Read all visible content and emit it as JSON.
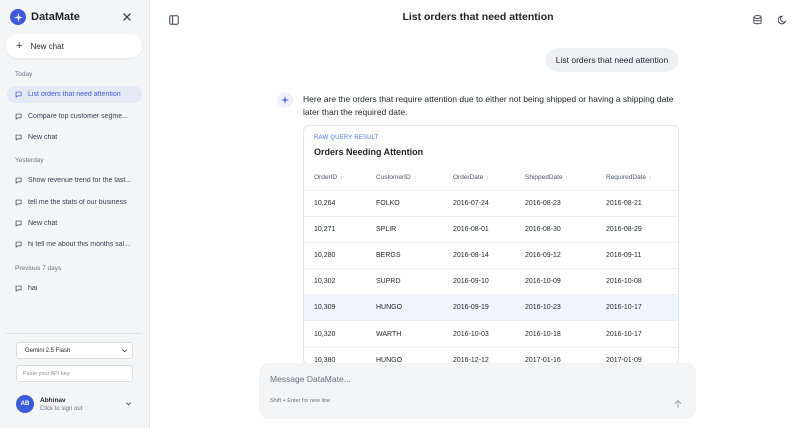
{
  "app": {
    "name": "DataMate"
  },
  "sidebar": {
    "new_chat_label": "New chat",
    "sections": [
      {
        "label": "Today",
        "items": [
          {
            "label": "List orders that need attention",
            "active": true
          },
          {
            "label": "Compare top customer segme..."
          },
          {
            "label": "New chat"
          }
        ]
      },
      {
        "label": "Yesterday",
        "items": [
          {
            "label": "Show revenue trend for the last..."
          },
          {
            "label": "tell me the stats of our business"
          },
          {
            "label": "New chat"
          },
          {
            "label": "hi tell me about this months sal..."
          }
        ]
      },
      {
        "label": "Previous 7 days",
        "items": [
          {
            "label": "hai"
          }
        ]
      }
    ],
    "model_select": {
      "value": "Gemini 2.5 Flash"
    },
    "api_key": {
      "placeholder": "Paste your API key"
    },
    "user": {
      "initials": "AB",
      "name": "Abhinav",
      "subtitle": "Click to sign out"
    }
  },
  "header": {
    "title": "List orders that need attention"
  },
  "conversation": {
    "user_message": "List orders that need attention",
    "assistant_message": "Here are the orders that require attention due to either not being shipped or having a shipping date later than the required date.",
    "result": {
      "kicker": "RAW QUERY RESULT",
      "title": "Orders Needing Attention",
      "columns": [
        "OrderID",
        "CustomerID",
        "OrderDate",
        "ShippedDate",
        "RequiredDate"
      ],
      "rows": [
        [
          "10,264",
          "FOLKO",
          "2016-07-24",
          "2016-08-23",
          "2016-08-21"
        ],
        [
          "10,271",
          "SPLIR",
          "2016-08-01",
          "2016-08-30",
          "2016-08-29"
        ],
        [
          "10,280",
          "BERGS",
          "2016-08-14",
          "2016-09-12",
          "2016-09-11"
        ],
        [
          "10,302",
          "SUPRD",
          "2016-09-10",
          "2016-10-09",
          "2016-10-08"
        ],
        [
          "10,309",
          "HUNGO",
          "2016-09-19",
          "2016-10-23",
          "2016-10-17"
        ],
        [
          "10,320",
          "WARTH",
          "2016-10-03",
          "2016-10-18",
          "2016-10-17"
        ],
        [
          "10,380",
          "HUNGO",
          "2016-12-12",
          "2017-01-16",
          "2017-01-09"
        ]
      ]
    }
  },
  "composer": {
    "placeholder": "Message DataMate...",
    "hint": "Shift + Enter for new line"
  },
  "colors": {
    "accent": "#3b5bdb",
    "sidebar_bg": "#f4f5f7",
    "active_item_bg": "#e5e9f5"
  }
}
